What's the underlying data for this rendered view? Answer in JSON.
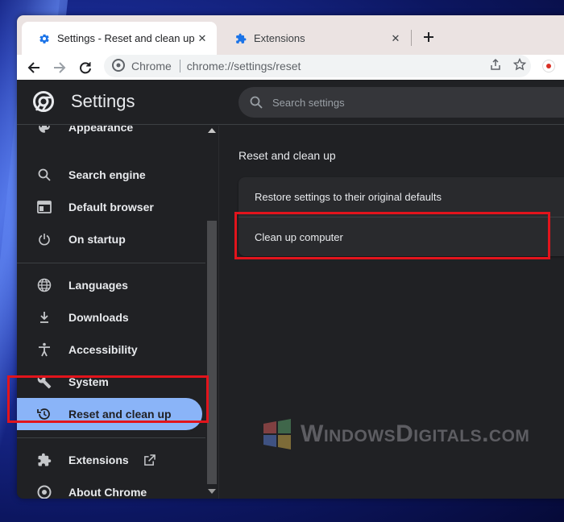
{
  "tabs": [
    {
      "title": "Settings - Reset and clean up",
      "icon": "gear-icon",
      "active": true
    },
    {
      "title": "Extensions",
      "icon": "puzzle-icon",
      "active": false
    }
  ],
  "new_tab_label": "+",
  "omnibox": {
    "site": "Chrome",
    "url": "chrome://settings/reset"
  },
  "header": {
    "title": "Settings",
    "search_placeholder": "Search settings"
  },
  "sidebar": {
    "items": [
      {
        "label": "Appearance",
        "icon": "palette-icon"
      },
      {
        "label": "Search engine",
        "icon": "search-icon"
      },
      {
        "label": "Default browser",
        "icon": "browser-icon"
      },
      {
        "label": "On startup",
        "icon": "power-icon"
      },
      {
        "label": "Languages",
        "icon": "globe-icon"
      },
      {
        "label": "Downloads",
        "icon": "download-icon"
      },
      {
        "label": "Accessibility",
        "icon": "accessibility-icon"
      },
      {
        "label": "System",
        "icon": "wrench-icon"
      },
      {
        "label": "Reset and clean up",
        "icon": "restore-icon",
        "selected": true
      },
      {
        "label": "Extensions",
        "icon": "puzzle-icon"
      },
      {
        "label": "About Chrome",
        "icon": "chrome-icon"
      }
    ]
  },
  "main": {
    "section_title": "Reset and clean up",
    "rows": [
      {
        "label": "Restore settings to their original defaults"
      },
      {
        "label": "Clean up computer"
      }
    ]
  },
  "watermark": {
    "text": "WindowsDigitals.com"
  },
  "colors": {
    "highlight": "#e2141c",
    "selected_nav": "#8ab4f8",
    "background": "#202124",
    "card": "#292a2d"
  }
}
